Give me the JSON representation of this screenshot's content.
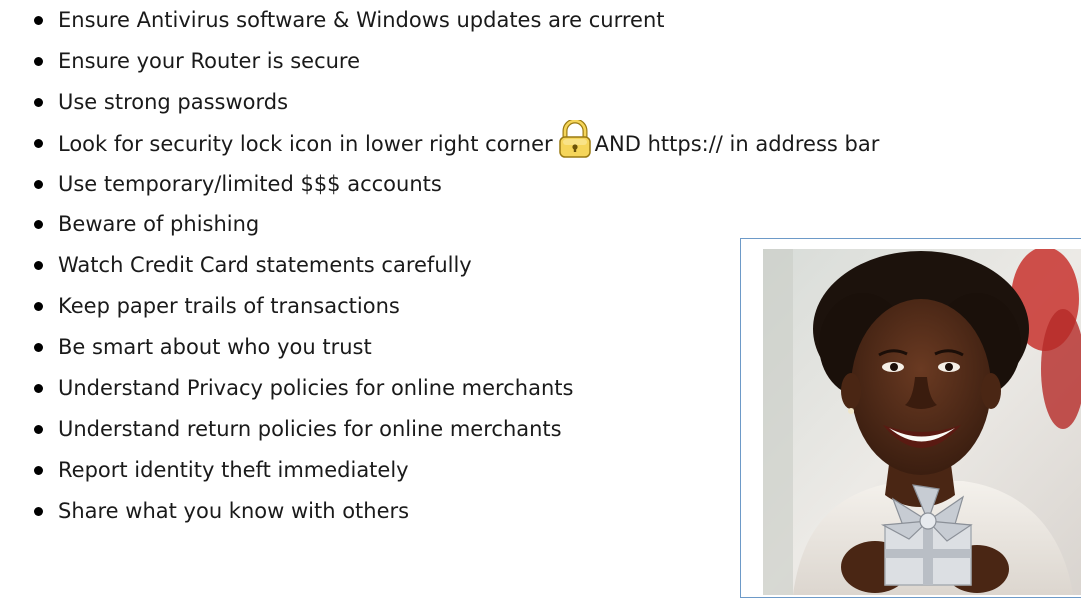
{
  "tips": [
    {
      "text": "Ensure Antivirus software & Windows updates are current"
    },
    {
      "text": "Ensure your Router is secure"
    },
    {
      "text": "Use strong passwords"
    },
    {
      "text_before": "Look for security lock icon in lower right corner",
      "icon": "padlock-icon",
      "text_after": "AND https:// in address bar"
    },
    {
      "text": "Use temporary/limited $$$ accounts"
    },
    {
      "text": "Beware of phishing"
    },
    {
      "text": "Watch Credit Card statements carefully"
    },
    {
      "text": "Keep paper trails of transactions"
    },
    {
      "text": "Be smart about who you trust"
    },
    {
      "text": "Understand Privacy policies for online merchants"
    },
    {
      "text": "Understand return policies for online merchants"
    },
    {
      "text": "Report identity theft immediately"
    },
    {
      "text": "Share what you know with others"
    }
  ],
  "colors": {
    "text": "#1a1a1a",
    "bullet": "#000000",
    "lock_fill": "#f5d55a",
    "lock_outline": "#9a7a12",
    "photo_border": "#6d9ac8"
  },
  "image": {
    "subject": "smiling-woman-holding-gift-photo"
  }
}
